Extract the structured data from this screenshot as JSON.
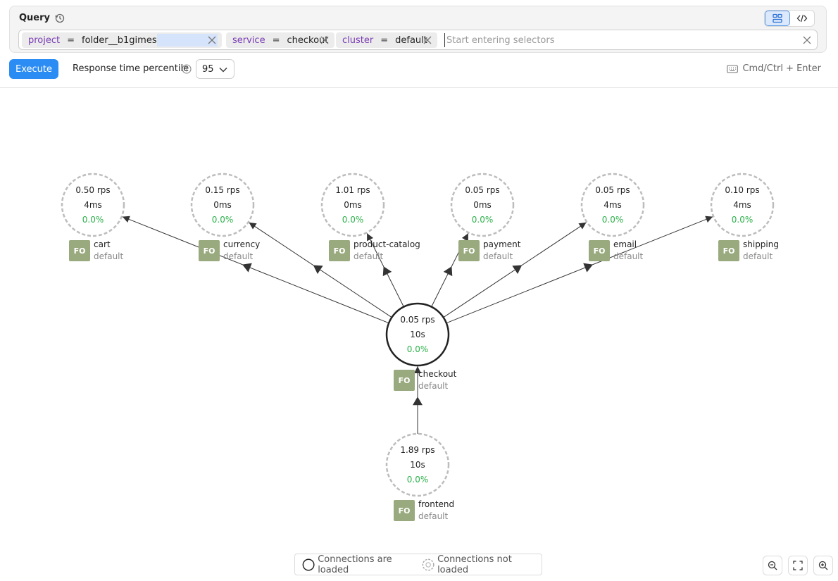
{
  "query": {
    "title": "Query",
    "chips": [
      {
        "key": "project",
        "op": "=",
        "value": "folder__b1gimes",
        "masked": true
      },
      {
        "key": "service",
        "op": "=",
        "value": "checkout"
      },
      {
        "key": "cluster",
        "op": "=",
        "value": "default"
      }
    ],
    "placeholder": "Start entering selectors"
  },
  "toolbar": {
    "execute_label": "Execute",
    "percentile_label": "Response time percentile",
    "percentile_value": "95",
    "shortcut_hint": "Cmd/Ctrl + Enter"
  },
  "colors": {
    "accent": "#2b8cf3",
    "badge": "#9aaa7f",
    "error_rate": "#2bb14a",
    "chip_key": "#7a3cb4"
  },
  "graph": {
    "nodes": [
      {
        "id": "cart",
        "rps": "0.50 rps",
        "latency": "4ms",
        "errors": "0.0%",
        "badge": "FO",
        "name": "cart",
        "cluster": "default",
        "loaded": false
      },
      {
        "id": "currency",
        "rps": "0.15 rps",
        "latency": "0ms",
        "errors": "0.0%",
        "badge": "FO",
        "name": "currency",
        "cluster": "default",
        "loaded": false
      },
      {
        "id": "product-catalog",
        "rps": "1.01 rps",
        "latency": "0ms",
        "errors": "0.0%",
        "badge": "FO",
        "name": "product-catalog",
        "cluster": "default",
        "loaded": false
      },
      {
        "id": "payment",
        "rps": "0.05 rps",
        "latency": "0ms",
        "errors": "0.0%",
        "badge": "FO",
        "name": "payment",
        "cluster": "default",
        "loaded": false
      },
      {
        "id": "email",
        "rps": "0.05 rps",
        "latency": "4ms",
        "errors": "0.0%",
        "badge": "FO",
        "name": "email",
        "cluster": "default",
        "loaded": false
      },
      {
        "id": "shipping",
        "rps": "0.10 rps",
        "latency": "4ms",
        "errors": "0.0%",
        "badge": "FO",
        "name": "shipping",
        "cluster": "default",
        "loaded": false
      },
      {
        "id": "checkout",
        "rps": "0.05 rps",
        "latency": "10s",
        "errors": "0.0%",
        "badge": "FO",
        "name": "checkout",
        "cluster": "default",
        "loaded": true
      },
      {
        "id": "frontend",
        "rps": "1.89 rps",
        "latency": "10s",
        "errors": "0.0%",
        "badge": "FO",
        "name": "frontend",
        "cluster": "default",
        "loaded": false
      }
    ],
    "edges": [
      {
        "from": "checkout",
        "to": "cart"
      },
      {
        "from": "checkout",
        "to": "currency"
      },
      {
        "from": "checkout",
        "to": "product-catalog"
      },
      {
        "from": "checkout",
        "to": "payment"
      },
      {
        "from": "checkout",
        "to": "email"
      },
      {
        "from": "checkout",
        "to": "shipping"
      },
      {
        "from": "frontend",
        "to": "checkout"
      }
    ]
  },
  "legend": {
    "loaded_label": "Connections are loaded",
    "not_loaded_label": "Connections not loaded"
  }
}
